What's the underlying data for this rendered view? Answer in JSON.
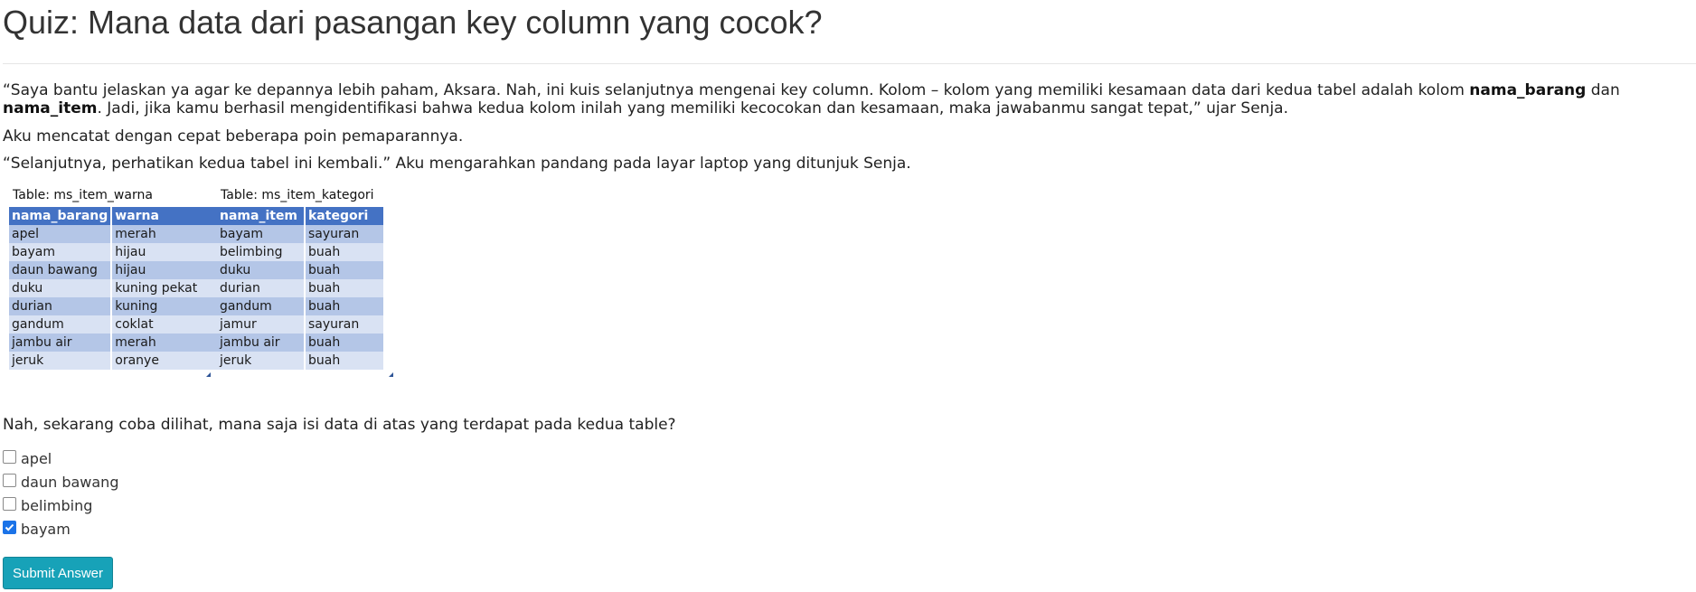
{
  "page": {
    "title": "Quiz: Mana data dari pasangan key column yang cocok?"
  },
  "story": {
    "p1_start": "“Saya bantu jelaskan ya agar ke depannya lebih paham, Aksara. Nah, ini kuis selanjutnya mengenai key column. Kolom – kolom yang memiliki kesamaan data dari kedua tabel adalah kolom ",
    "p1_bold1": "nama_barang",
    "p1_mid": " dan ",
    "p1_bold2": "nama_item",
    "p1_end": ". Jadi, jika kamu berhasil mengidentifikasi bahwa kedua kolom inilah yang memiliki kecocokan dan kesamaan, maka jawabanmu sangat tepat,” ujar Senja.",
    "p2": "Aku mencatat dengan cepat beberapa poin pemaparannya.",
    "p3": "“Selanjutnya, perhatikan kedua tabel ini kembali.” Aku mengarahkan pandang pada layar laptop yang ditunjuk Senja."
  },
  "tables": [
    {
      "caption": "Table: ms_item_warna",
      "headers": [
        "nama_barang",
        "warna"
      ],
      "rows": [
        [
          "apel",
          "merah"
        ],
        [
          "bayam",
          "hijau"
        ],
        [
          "daun bawang",
          "hijau"
        ],
        [
          "duku",
          "kuning pekat"
        ],
        [
          "durian",
          "kuning"
        ],
        [
          "gandum",
          "coklat"
        ],
        [
          "jambu air",
          "merah"
        ],
        [
          "jeruk",
          "oranye"
        ]
      ]
    },
    {
      "caption": "Table: ms_item_kategori",
      "headers": [
        "nama_item",
        "kategori"
      ],
      "rows": [
        [
          "bayam",
          "sayuran"
        ],
        [
          "belimbing",
          "buah"
        ],
        [
          "duku",
          "buah"
        ],
        [
          "durian",
          "buah"
        ],
        [
          "gandum",
          "buah"
        ],
        [
          "jamur",
          "sayuran"
        ],
        [
          "jambu air",
          "buah"
        ],
        [
          "jeruk",
          "buah"
        ]
      ]
    }
  ],
  "quiz": {
    "question": "Nah, sekarang coba dilihat, mana saja isi data di atas yang terdapat pada kedua table?",
    "options": [
      {
        "label": "apel",
        "checked": false
      },
      {
        "label": "daun bawang",
        "checked": false
      },
      {
        "label": "belimbing",
        "checked": false
      },
      {
        "label": "bayam",
        "checked": true
      }
    ],
    "submit_label": "Submit Answer"
  },
  "colors": {
    "table_header": "#4472c4",
    "table_row_odd": "#b4c6e7",
    "table_row_even": "#d9e2f3",
    "checkbox_checked": "#1b73e8",
    "submit_button": "#17a2b8"
  }
}
